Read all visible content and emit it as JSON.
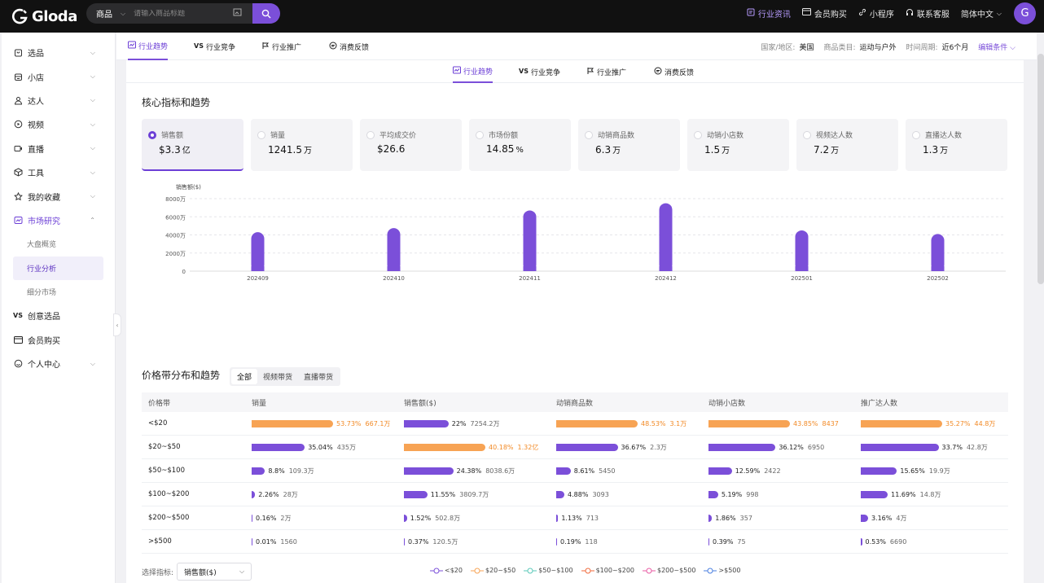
{
  "brand": {
    "name": "Gloda"
  },
  "search": {
    "type": "商品",
    "placeholder": "请输入商品标题"
  },
  "topnav": [
    {
      "label": "行业资讯",
      "icon": "news-icon",
      "active": true
    },
    {
      "label": "会员购买",
      "icon": "card-icon"
    },
    {
      "label": "小程序",
      "icon": "link-icon"
    },
    {
      "label": "联系客服",
      "icon": "headset-icon"
    },
    {
      "label": "简体中文",
      "icon": "chevron-down-icon"
    }
  ],
  "user": {
    "initial": "G"
  },
  "sidebar": {
    "items": [
      {
        "label": "选品",
        "icon": "bag-icon"
      },
      {
        "label": "小店",
        "icon": "shop-icon"
      },
      {
        "label": "达人",
        "icon": "user-icon"
      },
      {
        "label": "视频",
        "icon": "video-icon"
      },
      {
        "label": "直播",
        "icon": "live-icon"
      },
      {
        "label": "工具",
        "icon": "box-icon"
      },
      {
        "label": "我的收藏",
        "icon": "star-icon"
      },
      {
        "label": "市场研究",
        "icon": "chart-icon",
        "open": true
      }
    ],
    "sub": [
      {
        "label": "大盘概览"
      },
      {
        "label": "行业分析",
        "active": true
      },
      {
        "label": "细分市场"
      }
    ],
    "bottom": [
      {
        "label": "创意选品",
        "icon": "vs-icon"
      },
      {
        "label": "会员购买",
        "icon": "card-icon"
      },
      {
        "label": "个人中心",
        "icon": "smile-icon"
      }
    ]
  },
  "tabs": [
    {
      "label": "行业趋势",
      "icon": "trend-icon",
      "active": true
    },
    {
      "label": "行业竞争",
      "icon": "vs-icon"
    },
    {
      "label": "行业推广",
      "icon": "promote-icon"
    },
    {
      "label": "消费反馈",
      "icon": "feedback-icon"
    }
  ],
  "filters": {
    "region_label": "国家/地区:",
    "region": "美国",
    "category_label": "商品类目:",
    "category": "运动与户外",
    "period_label": "时间周期:",
    "period": "近6个月",
    "edit": "编辑条件"
  },
  "core": {
    "title": "核心指标和趋势"
  },
  "metrics": [
    {
      "label": "销售额",
      "value": "$3.3",
      "unit": "亿",
      "active": true
    },
    {
      "label": "销量",
      "value": "1241.5",
      "unit": "万"
    },
    {
      "label": "平均成交价",
      "value": "$26.6",
      "unit": ""
    },
    {
      "label": "市场份额",
      "value": "14.85",
      "unit": "%"
    },
    {
      "label": "动销商品数",
      "value": "6.3",
      "unit": "万"
    },
    {
      "label": "动销小店数",
      "value": "1.5",
      "unit": "万"
    },
    {
      "label": "视频达人数",
      "value": "7.2",
      "unit": "万"
    },
    {
      "label": "直播达人数",
      "value": "1.3",
      "unit": "万"
    }
  ],
  "chart_data": {
    "type": "bar",
    "ylabel": "销售额($)",
    "categories": [
      "202409",
      "202410",
      "202411",
      "202412",
      "202501",
      "202502"
    ],
    "values": [
      4300,
      4750,
      6700,
      7500,
      4500,
      4100
    ],
    "ylim": [
      0,
      8000
    ],
    "yticks": [
      "0",
      "2000万",
      "4000万",
      "6000万",
      "8000万"
    ],
    "yticks_values": [
      0,
      2000,
      4000,
      6000,
      8000
    ],
    "color": "#7b4fd9",
    "grid": true
  },
  "price": {
    "title": "价格带分布和趋势",
    "filters": [
      "全部",
      "视频带货",
      "直播带货"
    ],
    "headers": [
      "价格带",
      "销量",
      "销售额($)",
      "动销商品数",
      "动销小店数",
      "推广达人数"
    ],
    "rows": [
      {
        "band": "<$20",
        "cells": [
          {
            "pct": 53.73,
            "pct_label": "53.73%",
            "abs": "667.1万",
            "hi": true
          },
          {
            "pct": 22,
            "pct_label": "22%",
            "abs": "7254.2万"
          },
          {
            "pct": 48.53,
            "pct_label": "48.53%",
            "abs": "3.1万",
            "hi": true
          },
          {
            "pct": 43.85,
            "pct_label": "43.85%",
            "abs": "8437",
            "hi": true
          },
          {
            "pct": 35.27,
            "pct_label": "35.27%",
            "abs": "44.8万",
            "hi": true
          }
        ]
      },
      {
        "band": "$20~$50",
        "cells": [
          {
            "pct": 35.04,
            "pct_label": "35.04%",
            "abs": "435万"
          },
          {
            "pct": 40.18,
            "pct_label": "40.18%",
            "abs": "1.32亿",
            "hi": true
          },
          {
            "pct": 36.67,
            "pct_label": "36.67%",
            "abs": "2.3万"
          },
          {
            "pct": 36.12,
            "pct_label": "36.12%",
            "abs": "6950"
          },
          {
            "pct": 33.7,
            "pct_label": "33.7%",
            "abs": "42.8万"
          }
        ]
      },
      {
        "band": "$50~$100",
        "cells": [
          {
            "pct": 8.8,
            "pct_label": "8.8%",
            "abs": "109.3万"
          },
          {
            "pct": 24.38,
            "pct_label": "24.38%",
            "abs": "8038.6万"
          },
          {
            "pct": 8.61,
            "pct_label": "8.61%",
            "abs": "5450"
          },
          {
            "pct": 12.59,
            "pct_label": "12.59%",
            "abs": "2422"
          },
          {
            "pct": 15.65,
            "pct_label": "15.65%",
            "abs": "19.9万"
          }
        ]
      },
      {
        "band": "$100~$200",
        "cells": [
          {
            "pct": 2.26,
            "pct_label": "2.26%",
            "abs": "28万"
          },
          {
            "pct": 11.55,
            "pct_label": "11.55%",
            "abs": "3809.7万"
          },
          {
            "pct": 4.88,
            "pct_label": "4.88%",
            "abs": "3093"
          },
          {
            "pct": 5.19,
            "pct_label": "5.19%",
            "abs": "998"
          },
          {
            "pct": 11.69,
            "pct_label": "11.69%",
            "abs": "14.8万"
          }
        ]
      },
      {
        "band": "$200~$500",
        "cells": [
          {
            "pct": 0.16,
            "pct_label": "0.16%",
            "abs": "2万"
          },
          {
            "pct": 1.52,
            "pct_label": "1.52%",
            "abs": "502.8万"
          },
          {
            "pct": 1.13,
            "pct_label": "1.13%",
            "abs": "713"
          },
          {
            "pct": 1.86,
            "pct_label": "1.86%",
            "abs": "357"
          },
          {
            "pct": 3.16,
            "pct_label": "3.16%",
            "abs": "4万"
          }
        ]
      },
      {
        "band": ">$500",
        "cells": [
          {
            "pct": 0.01,
            "pct_label": "0.01%",
            "abs": "1560"
          },
          {
            "pct": 0.37,
            "pct_label": "0.37%",
            "abs": "120.5万"
          },
          {
            "pct": 0.19,
            "pct_label": "0.19%",
            "abs": "118"
          },
          {
            "pct": 0.39,
            "pct_label": "0.39%",
            "abs": "75"
          },
          {
            "pct": 0.53,
            "pct_label": "0.53%",
            "abs": "6690"
          }
        ]
      }
    ],
    "select_label": "选择指标:",
    "select_value": "销售额($)",
    "legend": [
      {
        "label": "<$20",
        "color": "#7b4fd9"
      },
      {
        "label": "$20~$50",
        "color": "#f7a354"
      },
      {
        "label": "$50~$100",
        "color": "#5ac8b8"
      },
      {
        "label": "$100~$200",
        "color": "#f06a3c"
      },
      {
        "label": "$200~$500",
        "color": "#e85aa3"
      },
      {
        "label": ">$500",
        "color": "#4a7fe0"
      }
    ]
  }
}
